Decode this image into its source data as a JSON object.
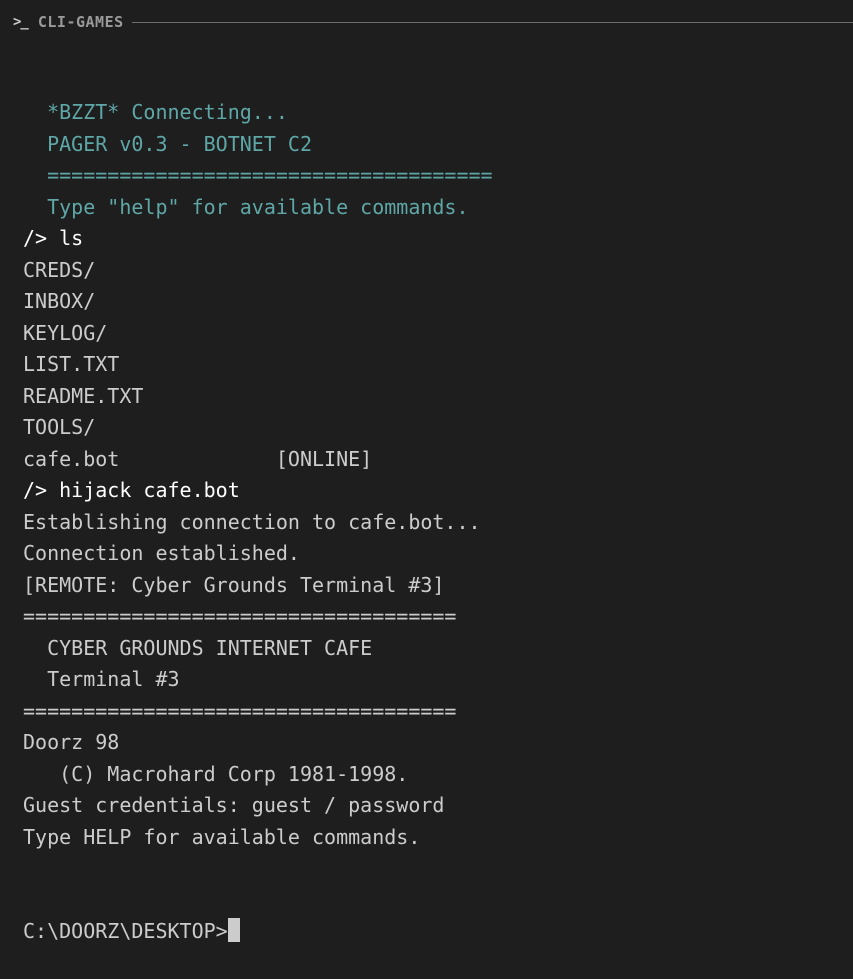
{
  "window": {
    "title": "CLI-GAMES",
    "prompt_glyph": ">_"
  },
  "terminal": {
    "lines": [
      {
        "text": "  *BZZT* Connecting...",
        "style": "teal"
      },
      {
        "text": "  PAGER v0.3 - BOTNET C2",
        "style": "teal"
      },
      {
        "text": "  =====================================",
        "style": "teal"
      },
      {
        "text": "  Type \"help\" for available commands.",
        "style": "teal"
      },
      {
        "text": "/> ls",
        "style": "cmd"
      },
      {
        "text": "CREDS/",
        "style": "out"
      },
      {
        "text": "INBOX/",
        "style": "out"
      },
      {
        "text": "KEYLOG/",
        "style": "out"
      },
      {
        "text": "LIST.TXT",
        "style": "out"
      },
      {
        "text": "README.TXT",
        "style": "out"
      },
      {
        "text": "TOOLS/",
        "style": "out"
      },
      {
        "text": "cafe.bot             [ONLINE]",
        "style": "out"
      },
      {
        "text": "/> hijack cafe.bot",
        "style": "cmd"
      },
      {
        "text": "Establishing connection to cafe.bot...",
        "style": "out"
      },
      {
        "text": "Connection established.",
        "style": "out"
      },
      {
        "text": "[REMOTE: Cyber Grounds Terminal #3]",
        "style": "out"
      },
      {
        "text": "====================================",
        "style": "out"
      },
      {
        "text": "  CYBER GROUNDS INTERNET CAFE",
        "style": "out"
      },
      {
        "text": "  Terminal #3",
        "style": "out"
      },
      {
        "text": "====================================",
        "style": "out"
      },
      {
        "text": "Doorz 98",
        "style": "out"
      },
      {
        "text": "   (C) Macrohard Corp 1981-1998.",
        "style": "out"
      },
      {
        "text": "Guest credentials: guest / password",
        "style": "out"
      },
      {
        "text": "Type HELP for available commands.",
        "style": "out"
      }
    ],
    "input_prompt": "C:\\DOORZ\\DESKTOP>",
    "input_value": ""
  },
  "colors": {
    "background": "#1e1e1e",
    "text": "#cccccc",
    "teal": "#5fa7a7",
    "command": "#ffffff"
  },
  "icons": {
    "titlebar_icon": "terminal-prompt-icon"
  }
}
